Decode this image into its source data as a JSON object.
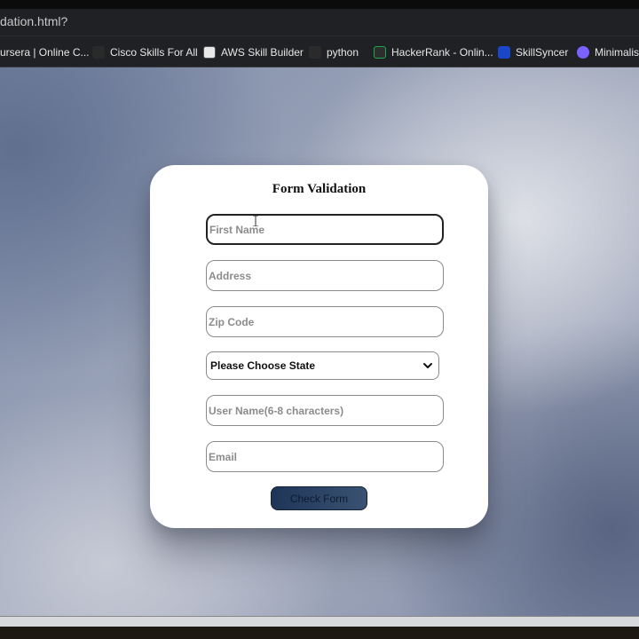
{
  "browser": {
    "url": "dation.html?",
    "bookmarks": [
      {
        "label": "ursera | Online C...",
        "icon": "coursera-icon",
        "color": "#202124"
      },
      {
        "label": "Cisco Skills For All",
        "icon": "cisco-icon",
        "color": "#2a2a2a"
      },
      {
        "label": "AWS Skill Builder",
        "icon": "aws-icon",
        "color": "#e8e8e8"
      },
      {
        "label": "python",
        "icon": "python-icon",
        "color": "#2a2a2a"
      },
      {
        "label": "HackerRank - Onlin...",
        "icon": "hackerrank-icon",
        "color": "#1ba94c"
      },
      {
        "label": "SkillSyncer",
        "icon": "skillsyncer-icon",
        "color": "#1a47c8"
      },
      {
        "label": "Minimalist",
        "icon": "minimalist-icon",
        "color": "#7b61ff"
      }
    ]
  },
  "form": {
    "title": "Form Validation",
    "fields": {
      "first_name": {
        "placeholder": "First Name",
        "value": ""
      },
      "address": {
        "placeholder": "Address",
        "value": ""
      },
      "zip": {
        "placeholder": "Zip Code",
        "value": ""
      },
      "username": {
        "placeholder": "User Name(6-8 characters)",
        "value": ""
      },
      "email": {
        "placeholder": "Email",
        "value": ""
      }
    },
    "state_select": {
      "selected": "Please Choose State"
    },
    "submit_label": "Check Form"
  }
}
